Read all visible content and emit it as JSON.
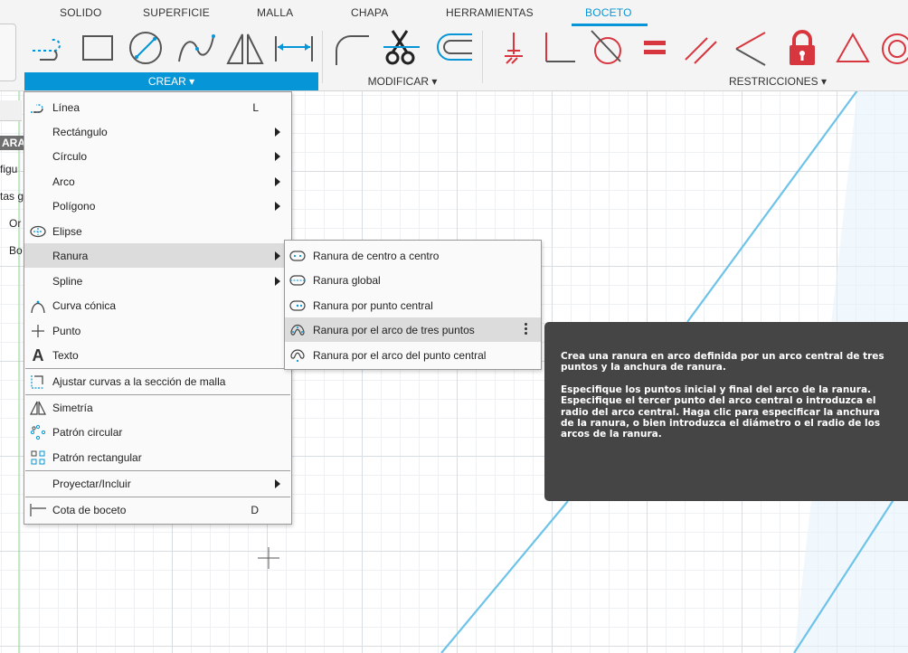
{
  "tabs": [
    {
      "label": "SOLIDO",
      "active": false
    },
    {
      "label": "SUPERFICIE",
      "active": false
    },
    {
      "label": "MALLA",
      "active": false
    },
    {
      "label": "CHAPA",
      "active": false
    },
    {
      "label": "HERRAMIENTAS",
      "active": false
    },
    {
      "label": "BOCETO",
      "active": true
    }
  ],
  "groups": {
    "crear": "CREAR ▾",
    "modificar": "MODIFICAR ▾",
    "restricciones": "RESTRICCIONES ▾"
  },
  "left_panel": [
    "ARA",
    "figu",
    "tas g",
    "Or",
    "Bo"
  ],
  "crear_menu": [
    {
      "label": "Línea",
      "shortcut": "L",
      "icon": "line-icon"
    },
    {
      "label": "Rectángulo",
      "submenu": true
    },
    {
      "label": "Círculo",
      "submenu": true
    },
    {
      "label": "Arco",
      "submenu": true
    },
    {
      "label": "Polígono",
      "submenu": true
    },
    {
      "label": "Elipse",
      "icon": "ellipse-icon"
    },
    {
      "label": "Ranura",
      "submenu": true,
      "highlighted": true
    },
    {
      "label": "Spline",
      "submenu": true
    },
    {
      "label": "Curva cónica",
      "icon": "conic-curve-icon"
    },
    {
      "label": "Punto",
      "icon": "point-icon"
    },
    {
      "label": "Texto",
      "icon": "text-icon"
    },
    {
      "label": "Ajustar curvas a la sección de malla",
      "icon": "fit-curves-icon"
    },
    {
      "label": "Simetría",
      "icon": "mirror-icon"
    },
    {
      "label": "Patrón circular",
      "icon": "circular-pattern-icon"
    },
    {
      "label": "Patrón rectangular",
      "icon": "rectangular-pattern-icon"
    },
    {
      "label": "Proyectar/Incluir",
      "submenu": true
    },
    {
      "label": "Cota de boceto",
      "shortcut": "D",
      "icon": "sketch-dimension-icon"
    }
  ],
  "ranura_submenu": [
    {
      "label": "Ranura de centro a centro",
      "icon": "center-to-center-slot-icon"
    },
    {
      "label": "Ranura global",
      "icon": "overall-slot-icon"
    },
    {
      "label": "Ranura por punto central",
      "icon": "center-point-slot-icon"
    },
    {
      "label": "Ranura por el arco de tres puntos",
      "icon": "three-point-arc-slot-icon",
      "highlighted": true
    },
    {
      "label": "Ranura por el arco del punto central",
      "icon": "center-point-arc-slot-icon"
    }
  ],
  "tooltip": {
    "title": "Crea una ranura en arco definida por un arco central de tres puntos y la anchura de ranura.",
    "body": "Especifique los puntos inicial y final del arco de la ranura. Especifique el tercer punto del arco central o introduzca el radio del arco central. Haga clic para especificar la anchura de la ranura, o bien introduzca el diámetro o el radio de los arcos de la ranura."
  },
  "colors": {
    "accent": "#0696d7",
    "constraint_red": "#d8363f",
    "slot_line": "#6ec3e8",
    "tooltip_bg": "#454545"
  }
}
